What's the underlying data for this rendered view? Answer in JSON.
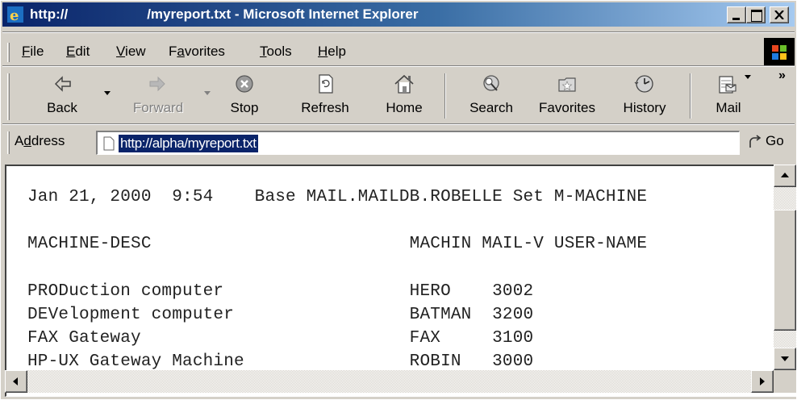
{
  "window": {
    "title_prefix": "http://",
    "title_suffix": "/myreport.txt - Microsoft Internet Explorer"
  },
  "menu": {
    "items": [
      {
        "pre": "",
        "key": "F",
        "post": "ile"
      },
      {
        "pre": "",
        "key": "E",
        "post": "dit"
      },
      {
        "pre": "",
        "key": "V",
        "post": "iew"
      },
      {
        "pre": "F",
        "key": "a",
        "post": "vorites"
      },
      {
        "pre": "",
        "key": "T",
        "post": "ools"
      },
      {
        "pre": "",
        "key": "H",
        "post": "elp"
      }
    ]
  },
  "toolbar": {
    "back": "Back",
    "forward": "Forward",
    "stop": "Stop",
    "refresh": "Refresh",
    "home": "Home",
    "search": "Search",
    "favorites": "Favorites",
    "history": "History",
    "mail": "Mail",
    "more": "»"
  },
  "address": {
    "label_pre": "A",
    "label_key": "d",
    "label_post": "dress",
    "url": "http://alpha/myreport.txt",
    "go": "Go"
  },
  "document": {
    "lines": [
      "Jan 21, 2000  9:54    Base MAIL.MAILDB.ROBELLE Set M-MACHINE",
      "",
      "MACHINE-DESC                         MACHIN MAIL-V USER-NAME",
      "",
      "PRODuction computer                  HERO    3002",
      "DEVelopment computer                 BATMAN  3200",
      "FAX Gateway                          FAX     3100",
      "HP-UX Gateway Machine                ROBIN   3000"
    ]
  },
  "colors": {
    "title_gradient_start": "#0a246a",
    "title_gradient_end": "#a6caf0",
    "selection": "#0a246a",
    "chrome": "#d4d0c8"
  }
}
